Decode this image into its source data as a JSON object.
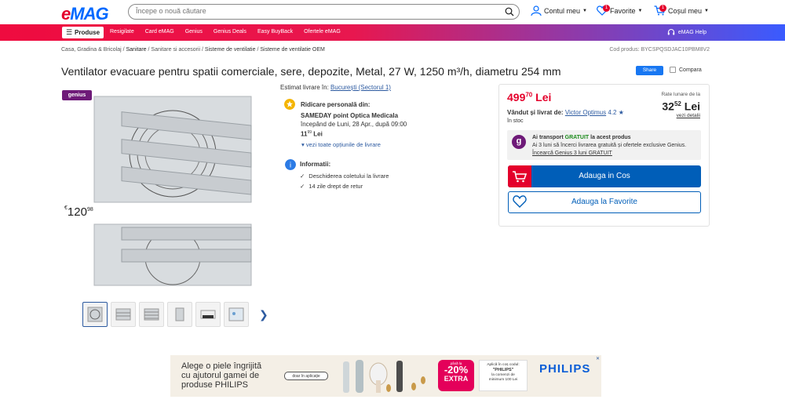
{
  "header": {
    "logo_e": "e",
    "logo_mag": "MAG",
    "search_placeholder": "Începe o nouă căutare",
    "account_label": "Contul meu",
    "favorites_label": "Favorite",
    "favorites_count": "1",
    "cart_label": "Coșul meu",
    "cart_count": "1"
  },
  "nav": {
    "products_label": "Produse",
    "links": [
      "Resigilate",
      "Card eMAG",
      "Genius",
      "Genius Deals",
      "Easy BuyBack",
      "Ofertele eMAG"
    ],
    "help_label": "eMAG Help"
  },
  "breadcrumb": {
    "items": [
      "Casa, Gradina & Bricolaj",
      "Sanitare",
      "Sanitare si accesorii",
      "Sisteme de ventilatie",
      "Sisteme de ventilatie OEM"
    ]
  },
  "product": {
    "code": "Cod produs: BYCSPQSDJAC10PBM8V2",
    "title": "Ventilator evacuare pentru spatii comerciale, sere, depozite, Metal, 27 W, 1250 m³/h, diametru 254 mm",
    "share_label": "Share",
    "compare_label": "Compara",
    "genius_badge": "genius",
    "old_price_currency": "€",
    "old_price_int": "120",
    "old_price_dec": "98"
  },
  "delivery": {
    "estimate_label": "Estimat livrare în:",
    "estimate_location": "București (Sectorul 1)",
    "pickup_title": "Ridicare personală din:",
    "pickup_point": "SAMEDAY point Optica Medicala",
    "pickup_from": "începând de Luni, 28 Apr., după 09:00",
    "pickup_price_int": "11",
    "pickup_price_dec": "99",
    "pickup_currency": "Lei",
    "more_options": "vezi toate opțiunile de livrare",
    "info_title": "Informatii:",
    "info_items": [
      "Deschiderea coletului la livrare",
      "14 zile drept de retur"
    ]
  },
  "buybox": {
    "price_int": "499",
    "price_dec": "70",
    "price_currency": "Lei",
    "rate_label": "Rate lunare de la",
    "rate_int": "32",
    "rate_dec": "52",
    "rate_currency": "Lei",
    "rate_link": "vezi detalii",
    "sold_by_label": "Vândut și livrat de:",
    "seller_name": "Victor Optimus",
    "seller_rating": "4.2",
    "stock": "în stoc",
    "genius_line1_a": "Ai transport",
    "genius_line1_free": "GRATUIT",
    "genius_line1_b": "la acest produs",
    "genius_line2": "Ai 3 luni să încerci livrarea gratuită și ofertele exclusive Genius.",
    "genius_line3": "Încearcă Genius 3 luni GRATUIT",
    "add_to_cart": "Adauga in Cos",
    "add_to_fav": "Adauga la Favorite"
  },
  "ad": {
    "text_line1": "Alege o piele îngrijită",
    "text_line2": "cu ajutorul gamei de",
    "text_line3": "produse PHILIPS",
    "app_badge": "doar în aplicație",
    "pct_a": "până la",
    "pct_b": "-20%",
    "pct_c": "EXTRA",
    "code_line1": "Aplică în coș codul:",
    "code_value": "\"PHILIPS\"",
    "code_line3": "la comenzi de",
    "code_line4": "minimum 100 Lei",
    "brand": "PHILIPS",
    "close": "✕"
  },
  "colors": {
    "brand_red": "#e4002b",
    "brand_blue": "#005eb8",
    "genius_purple": "#6e1a78"
  }
}
